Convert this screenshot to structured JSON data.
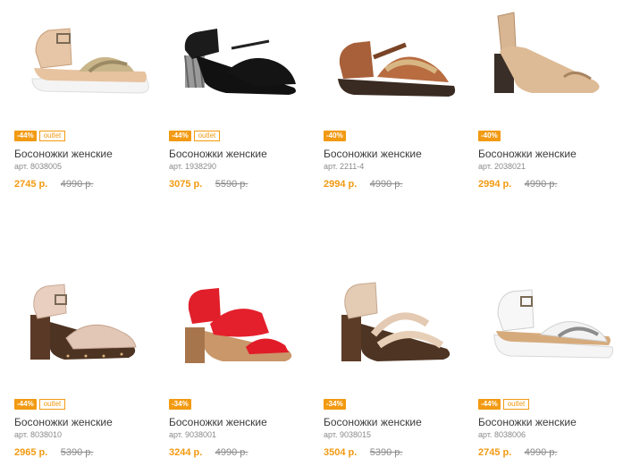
{
  "colors": {
    "accent": "#f29a12",
    "text": "#3b3b3b",
    "muted": "#8a8a8a"
  },
  "products": [
    {
      "discount": "-44%",
      "outlet": "outlet",
      "title": "Босоножки женские",
      "sku": "арт. 8038005",
      "price": "2745 р.",
      "old_price": "4990 р.",
      "image": "beige-wedge-sandal-icon"
    },
    {
      "discount": "-44%",
      "outlet": "outlet",
      "title": "Босоножки женские",
      "sku": "арт. 1938290",
      "price": "3075 р.",
      "old_price": "5590 р.",
      "image": "black-heel-sandal-icon"
    },
    {
      "discount": "-40%",
      "outlet": "",
      "title": "Босоножки женские",
      "sku": "арт. 2211-4",
      "price": "2994 р.",
      "old_price": "4990 р.",
      "image": "brown-strap-sandal-icon"
    },
    {
      "discount": "-40%",
      "outlet": "",
      "title": "Босоножки женские",
      "sku": "арт. 2038021",
      "price": "2994 р.",
      "old_price": "4990 р.",
      "image": "beige-peeptoe-slingback-icon"
    },
    {
      "discount": "-44%",
      "outlet": "outlet",
      "title": "Босоножки женские",
      "sku": "арт. 8038010",
      "price": "2965 р.",
      "old_price": "5390 р.",
      "image": "lace-block-heel-sandal-icon"
    },
    {
      "discount": "-34%",
      "outlet": "",
      "title": "Босоножки женские",
      "sku": "арт. 9038001",
      "price": "3244 р.",
      "old_price": "4990 р.",
      "image": "red-heel-sandal-icon"
    },
    {
      "discount": "-34%",
      "outlet": "",
      "title": "Босоножки женские",
      "sku": "арт. 9038015",
      "price": "3504 р.",
      "old_price": "5390 р.",
      "image": "beige-cross-strap-sandal-icon"
    },
    {
      "discount": "-44%",
      "outlet": "outlet",
      "title": "Босоножки женские",
      "sku": "арт. 8038006",
      "price": "2745 р.",
      "old_price": "4990 р.",
      "image": "white-wedge-sandal-icon"
    }
  ]
}
